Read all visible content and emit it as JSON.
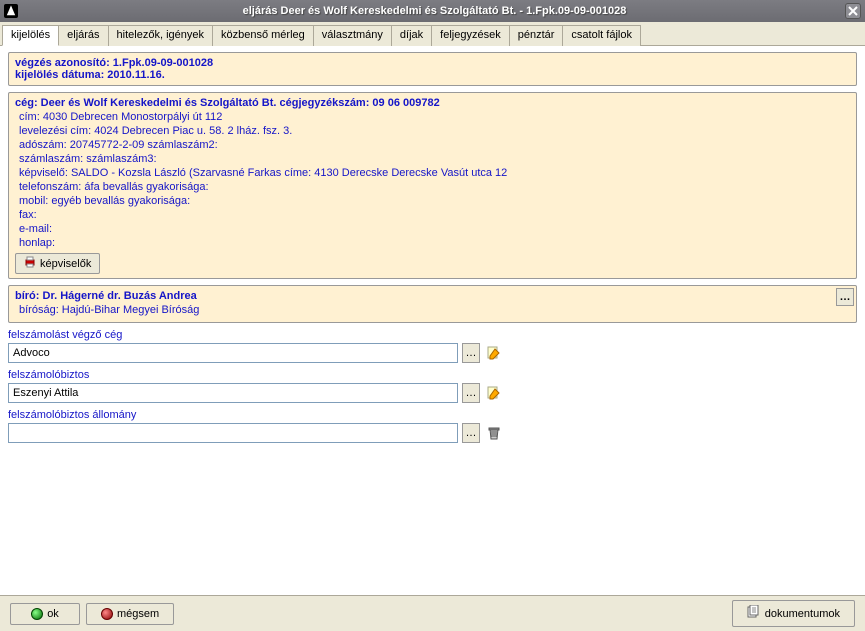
{
  "window": {
    "title": "eljárás Deer és Wolf Kereskedelmi és Szolgáltató  Bt. - 1.Fpk.09-09-001028"
  },
  "tabs": [
    "kijelölés",
    "eljárás",
    "hitelezők, igények",
    "közbenső mérleg",
    "választmány",
    "díjak",
    "feljegyzések",
    "pénztár",
    "csatolt fájlok"
  ],
  "panel1": {
    "line1": "végzés azonosító: 1.Fpk.09-09-001028",
    "line2": "kijelölés dátuma: 2010.11.16."
  },
  "panel2": {
    "header": "cég: Deer és Wolf Kereskedelmi és Szolgáltató  Bt. cégjegyzékszám: 09 06 009782",
    "rows": [
      "cím: 4030 Debrecen Monostorpályi út 112",
      "levelezési cím: 4024 Debrecen Piac u. 58. 2 lház. fsz. 3.",
      "adószám: 20745772-2-09 számlaszám2:",
      "számlaszám:  számlaszám3:",
      "képviselő: SALDO - Kozsla László (Szarvasné Farkas  címe: 4130 Derecske Derecske Vasút utca 12",
      "telefonszám:  áfa bevallás gyakorisága:",
      "mobil:  egyéb bevallás gyakorisága:",
      "fax:",
      "e-mail:",
      "honlap:"
    ],
    "repr_btn": "képviselők"
  },
  "panel3": {
    "header": "bíró: Dr. Hágerné dr. Buzás Andrea",
    "row": "bíróság: Hajdú-Bihar Megyei Bíróság"
  },
  "fields": {
    "company_label": "felszámolást végző cég",
    "company_value": "Advoco",
    "trustee_label": "felszámolóbiztos",
    "trustee_value": "Eszenyi Attila",
    "staff_label": "felszámolóbiztos állomány",
    "staff_value": ""
  },
  "footer": {
    "ok": "ok",
    "cancel": "mégsem",
    "docs": "dokumentumok"
  }
}
